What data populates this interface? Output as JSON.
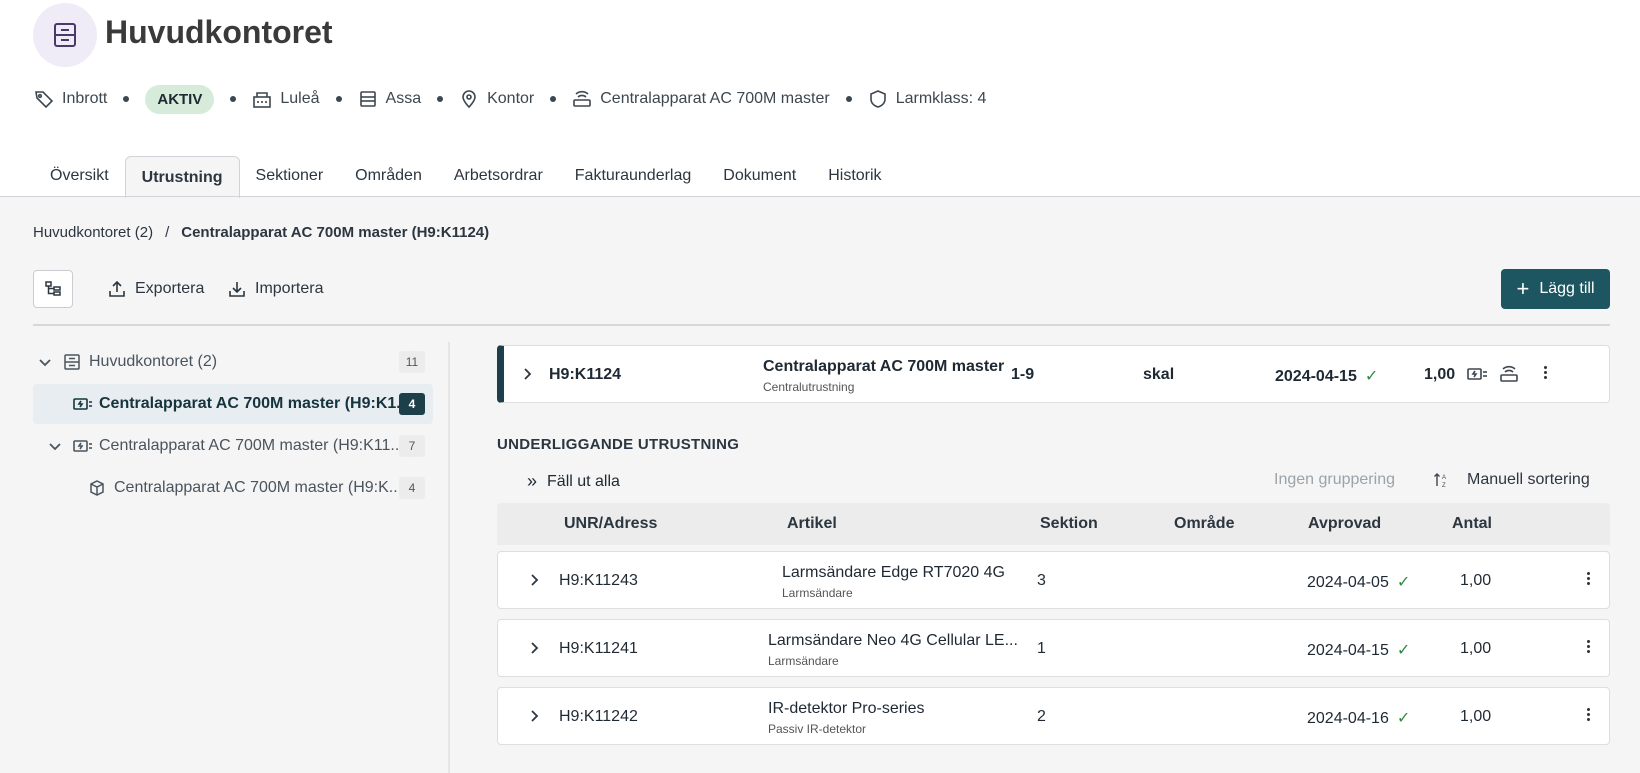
{
  "site": {
    "title": "Huvudkontoret",
    "icon": "cabinet-icon",
    "meta": {
      "type": "Inbrott",
      "status": "AKTIV",
      "city": "Luleå",
      "brand": "Assa",
      "location_type": "Kontor",
      "central": "Centralapparat AC 700M master",
      "alarm_class": "Larmklass: 4"
    }
  },
  "tabs": [
    "Översikt",
    "Utrustning",
    "Sektioner",
    "Områden",
    "Arbetsordrar",
    "Fakturaunderlag",
    "Dokument",
    "Historik"
  ],
  "active_tab": "Utrustning",
  "breadcrumb": {
    "parent": "Huvudkontoret (2)",
    "separator": "/",
    "current": "Centralapparat AC 700M master (H9:K1124)"
  },
  "toolbar": {
    "export_label": "Exportera",
    "import_label": "Importera",
    "add_label": "Lägg till"
  },
  "tree": [
    {
      "label": "Huvudkontoret (2)",
      "count": "11"
    },
    {
      "label": "Centralapparat AC 700M master (H9:K1...",
      "count": "4"
    },
    {
      "label": "Centralapparat AC 700M master (H9:K11...",
      "count": "7"
    },
    {
      "label": "Centralapparat AC 700M master (H9:K...",
      "count": "4"
    }
  ],
  "master": {
    "unr": "H9:K1124",
    "article": "Centralapparat AC 700M master",
    "article_type": "Centralutrustning",
    "section": "1-9",
    "area": "skal",
    "approved": "2024-04-15",
    "quantity": "1,00"
  },
  "equipment": {
    "title": "UNDERLIGGANDE UTRUSTNING",
    "expand_all": "Fäll ut alla",
    "grouping": "Ingen gruppering",
    "sorting": "Manuell sortering",
    "columns": [
      "UNR/Adress",
      "Artikel",
      "Sektion",
      "Område",
      "Avprovad",
      "Antal"
    ],
    "rows": [
      {
        "unr": "H9:K11243",
        "article": "Larmsändare Edge RT7020 4G",
        "article_type": "Larmsändare",
        "section": "3",
        "area": "",
        "approved": "2024-04-05",
        "quantity": "1,00"
      },
      {
        "unr": "H9:K11241",
        "article": "Larmsändare Neo 4G Cellular LE...",
        "article_type": "Larmsändare",
        "section": "1",
        "area": "",
        "approved": "2024-04-15",
        "quantity": "1,00"
      },
      {
        "unr": "H9:K11242",
        "article": "IR-detektor Pro-series",
        "article_type": "Passiv IR-detektor",
        "section": "2",
        "area": "",
        "approved": "2024-04-16",
        "quantity": "1,00"
      }
    ]
  },
  "colors": {
    "primary": "#1d5661",
    "dark": "#1d3f4a",
    "success": "#2f8a3e",
    "badge": "#d6ebd9"
  }
}
